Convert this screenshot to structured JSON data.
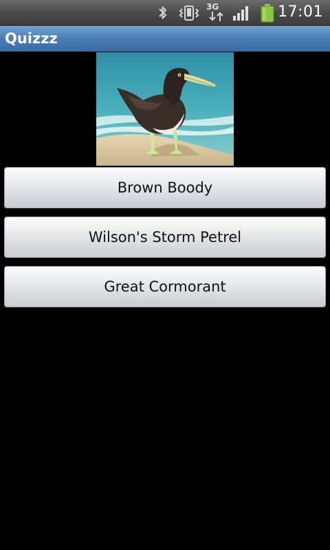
{
  "status_bar": {
    "time": "17:01",
    "network": "3G",
    "icons": [
      "bluetooth-icon",
      "vibrate-icon",
      "network-3g-icon",
      "signal-icon",
      "battery-icon"
    ]
  },
  "app": {
    "title": "Quizzz"
  },
  "question": {
    "image_subject": "bird-photo",
    "answers": [
      {
        "label": "Brown Boody"
      },
      {
        "label": "Wilson's Storm Petrel"
      },
      {
        "label": "Great Cormorant"
      }
    ]
  },
  "colors": {
    "title_bar": "#4a7db6",
    "background": "#000000",
    "battery": "#8dc63f"
  }
}
